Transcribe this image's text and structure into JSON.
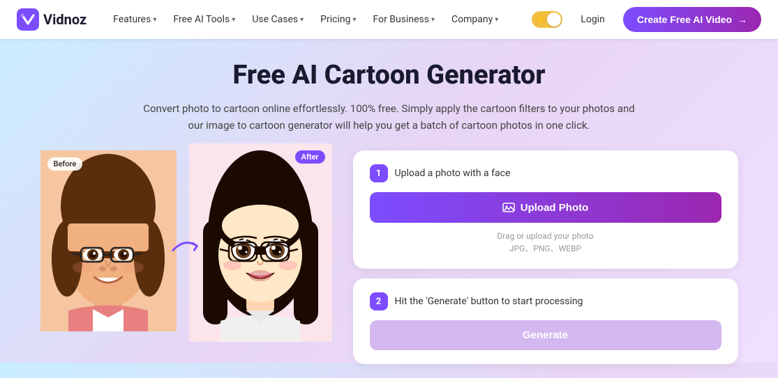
{
  "header": {
    "logo_text": "Vidnoz",
    "nav": [
      {
        "label": "Features",
        "has_dropdown": true
      },
      {
        "label": "Free AI Tools",
        "has_dropdown": true
      },
      {
        "label": "Use Cases",
        "has_dropdown": true
      },
      {
        "label": "Pricing",
        "has_dropdown": true
      },
      {
        "label": "For Business",
        "has_dropdown": true
      },
      {
        "label": "Company",
        "has_dropdown": true
      }
    ],
    "login_label": "Login",
    "cta_label": "Create Free AI Video",
    "cta_arrow": "→"
  },
  "hero": {
    "title": "Free AI Cartoon Generator",
    "description": "Convert photo to cartoon online effortlessly. 100% free. Simply apply the cartoon filters to your photos and our image to cartoon generator will help you get a batch of cartoon photos in one click."
  },
  "before_badge": "Before",
  "after_badge": "After",
  "steps": [
    {
      "num": "1",
      "label": "Upload a photo with a face",
      "button_label": "Upload Photo",
      "hint_line1": "Drag or upload your photo",
      "hint_line2": "JPG、PNG、WEBP"
    },
    {
      "num": "2",
      "label": "Hit the 'Generate' button to start processing",
      "button_label": "Generate"
    }
  ]
}
